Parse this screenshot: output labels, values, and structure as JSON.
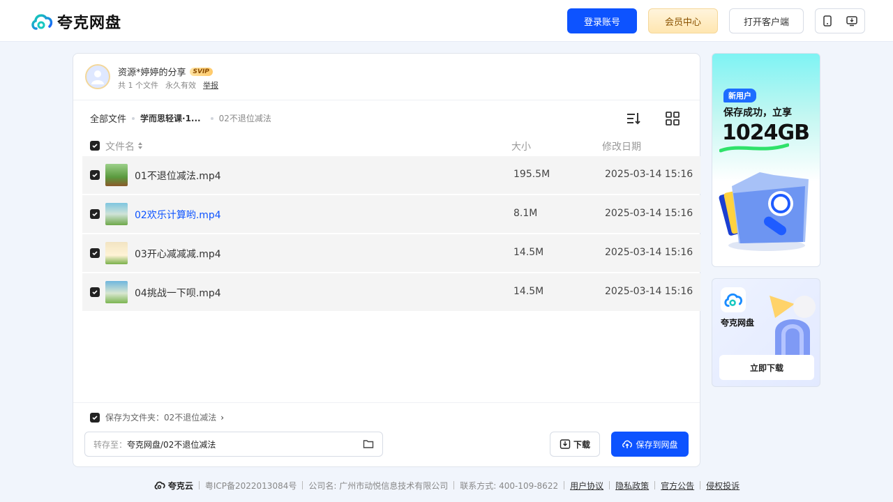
{
  "header": {
    "logo_text": "夸克网盘",
    "login_label": "登录账号",
    "vip_label": "会员中心",
    "client_label": "打开客户端"
  },
  "share": {
    "title": "资源*婷婷的分享",
    "badge": "SVIP",
    "file_count": "共 1 个文件",
    "validity": "永久有效",
    "report": "举报"
  },
  "breadcrumb": {
    "root": "全部文件",
    "mid": "学而思轻课·1...",
    "current": "02不退位减法"
  },
  "columns": {
    "name": "文件名",
    "size": "大小",
    "date": "修改日期"
  },
  "files": [
    {
      "name": "01不退位减法.mp4",
      "size": "195.5M",
      "date": "2025-03-14 15:16"
    },
    {
      "name": "02欢乐计算哟.mp4",
      "size": "8.1M",
      "date": "2025-03-14 15:16"
    },
    {
      "name": "03开心减减减.mp4",
      "size": "14.5M",
      "date": "2025-03-14 15:16"
    },
    {
      "name": "04挑战一下呗.mp4",
      "size": "14.5M",
      "date": "2025-03-14 15:16"
    }
  ],
  "save": {
    "save_as_folder": "保存为文件夹：02不退位减法",
    "path_label": "转存至：",
    "path_value": "夸克网盘/02不退位减法",
    "download_label": "下载",
    "save_label": "保存到网盘"
  },
  "ads": {
    "tag": "新用户",
    "line1": "保存成功，立享",
    "big": "1024GB",
    "brand": "夸克网盘",
    "download": "立即下载"
  },
  "footer": {
    "brand": "夸克云",
    "icp": "粤ICP备2022013084号",
    "company": "公司名: 广州市动悦信息技术有限公司",
    "contact": "联系方式: 400-109-8622",
    "links": [
      "用户协议",
      "隐私政策",
      "官方公告",
      "侵权投诉"
    ]
  },
  "colors": {
    "accent": "#0d53ff",
    "active_file": "#0d53ff"
  }
}
